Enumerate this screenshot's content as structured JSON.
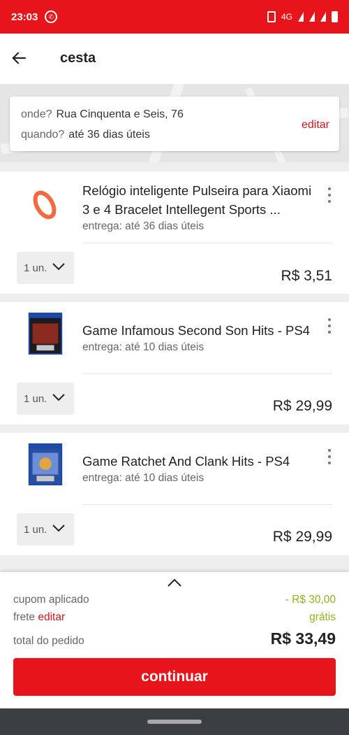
{
  "status_bar": {
    "time": "23:03",
    "network": "4G"
  },
  "header": {
    "title": "cesta"
  },
  "address_card": {
    "where_label": "onde?",
    "where_value": "Rua Cinquenta e Seis, 76",
    "when_label": "quando?",
    "when_value": "até 36 dias úteis",
    "edit_label": "editar"
  },
  "items": [
    {
      "name": "Relógio inteligente Pulseira para Xiaomi 3 e 4 Bracelet Intellegent Sports ...",
      "delivery": "entrega: até 36 dias úteis",
      "quantity": "1 un.",
      "price": "R$ 3,51",
      "thumb_icon": "orange-band-icon"
    },
    {
      "name": "Game Infamous Second Son Hits - PS4",
      "delivery": "entrega: até 10 dias úteis",
      "quantity": "1 un.",
      "price": "R$ 29,99",
      "thumb_icon": "game-case-icon"
    },
    {
      "name": "Game Ratchet And Clank Hits - PS4",
      "delivery": "entrega: até 10 dias úteis",
      "quantity": "1 un.",
      "price": "R$ 29,99",
      "thumb_icon": "game-case-icon"
    }
  ],
  "summary": {
    "coupon_label": "cupom aplicado",
    "coupon_value": "- R$ 30,00",
    "shipping_label": "frete",
    "shipping_edit": "editar",
    "shipping_value": "grátis",
    "total_label": "total do pedido",
    "total_value": "R$ 33,49",
    "continue_label": "continuar"
  },
  "colors": {
    "brand_red": "#e8141c",
    "discount_green": "#8db31d"
  }
}
